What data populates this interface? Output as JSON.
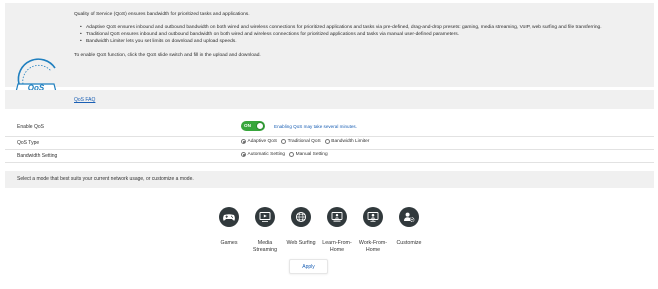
{
  "intro": {
    "logo_text": "QoS",
    "heading": "Quality of Service (QoS) ensures bandwidth for prioritized tasks and applications.",
    "bullets": [
      "Adaptive QoS ensures inbound and outbound bandwidth on both wired and wireless connections for prioritized applications and tasks via pre-defined, drag-and-drop presets: gaming, media streaming, VoIP, web surfing and file transferring.",
      "Traditional QoS ensures inbound and outbound bandwidth on both wired and wireless connections for prioritized applications and tasks via manual user-defined parameters.",
      "Bandwidth Limiter lets you set limits on download and upload speeds."
    ],
    "footer": "To enable QoS function, click the QoS slide switch and fill in the upload and download."
  },
  "faq": {
    "link": "QoS FAQ"
  },
  "settings": {
    "enable_qos": {
      "label": "Enable QoS",
      "state": "ON",
      "note": "Enabling QoS may take several minutes."
    },
    "qos_type": {
      "label": "QoS Type",
      "options": [
        "Adaptive QoS",
        "Traditional QoS",
        "Bandwidth Limiter"
      ],
      "selected": "Adaptive QoS"
    },
    "bandwidth": {
      "label": "Bandwidth Setting",
      "options": [
        "Automatic Setting",
        "Manual Setting"
      ],
      "selected": "Automatic Setting"
    }
  },
  "hint": "Select a mode that best suits your current network usage, or customize a mode.",
  "modes": [
    {
      "label": "Games",
      "icon": "gamepad-icon"
    },
    {
      "label": "Media\nStreaming",
      "icon": "media-streaming-icon"
    },
    {
      "label": "Web Surfing",
      "icon": "web-surfing-icon"
    },
    {
      "label": "Learn-From-\nHome",
      "icon": "learn-from-home-icon"
    },
    {
      "label": "Work-From-\nHome",
      "icon": "work-from-home-icon"
    },
    {
      "label": "Customize",
      "icon": "customize-icon"
    }
  ],
  "apply_label": "Apply",
  "colors": {
    "accent": "#1a5fb4",
    "toggle_on": "#38a63c",
    "icon_bg": "#31393c",
    "logo": "#1f7fbf"
  }
}
